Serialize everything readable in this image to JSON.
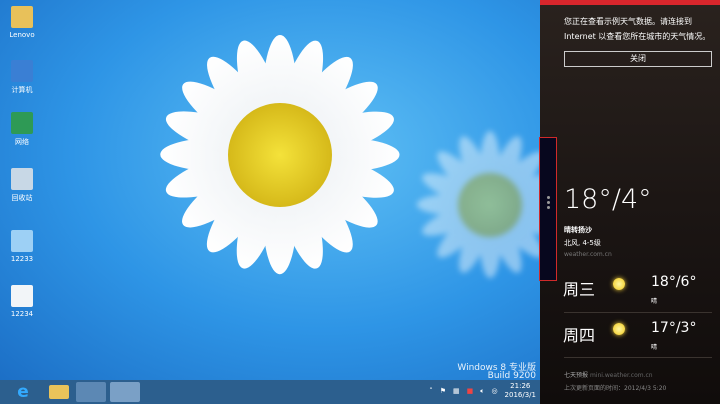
{
  "desktop": {
    "icons": [
      {
        "label": "Lenovo",
        "icon": "folder-icon"
      },
      {
        "label": "计算机",
        "icon": "computer-icon"
      },
      {
        "label": "网络",
        "icon": "network-icon"
      },
      {
        "label": "回收站",
        "icon": "recycle-bin-icon"
      },
      {
        "label": "12233",
        "icon": "image-file-icon"
      },
      {
        "label": "12234",
        "icon": "image-file-icon"
      }
    ],
    "watermark": {
      "line1": "Windows 8 专业版",
      "line2": "Build 9200"
    }
  },
  "taskbar": {
    "time": "21:26",
    "date": "2016/3/1"
  },
  "weather": {
    "notice": "您正在查看示例天气数据。请连接到 Internet 以查看您所在城市的天气情况。",
    "close_label": "关闭",
    "current": {
      "temp": "18°/4°",
      "condition": "晴转扬沙",
      "wind": "北风, 4-5级",
      "source": "weather.com.cn"
    },
    "forecast": [
      {
        "day": "周三",
        "temp": "18°/6°",
        "condition": "晴"
      },
      {
        "day": "周四",
        "temp": "17°/3°",
        "condition": "晴"
      }
    ],
    "seven_day_label": "七天预报",
    "seven_day_link": "mini.weather.com.cn",
    "updated": "上次更新页面的时间：2012/4/3 5:20"
  },
  "colors": {
    "accent": "#d8262c"
  }
}
